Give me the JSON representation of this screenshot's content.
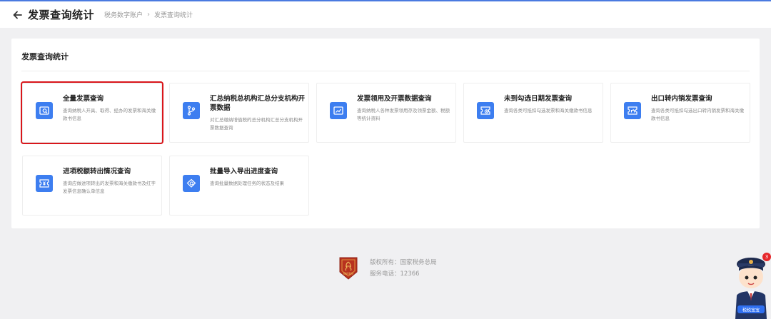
{
  "header": {
    "title": "发票查询统计",
    "breadcrumb": [
      "税务数字账户",
      "发票查询统计"
    ]
  },
  "section": {
    "title": "发票查询统计"
  },
  "cards": [
    {
      "title": "全量发票查询",
      "desc": "查询纳税人开具、取得、经办的发票和海关缴款书信息",
      "icon": "invoice-search-icon"
    },
    {
      "title": "汇总纳税总机构汇总分支机构开票数据",
      "desc": "对汇总缴纳增值税的总分机构汇总分支机构开票数据查询",
      "icon": "branch-icon"
    },
    {
      "title": "发票领用及开票数据查询",
      "desc": "查询纳税人各种发票领用存及领票金额、税额等统计资料",
      "icon": "trend-chart-icon"
    },
    {
      "title": "未到勾选日期发票查询",
      "desc": "查询各类可抵扣勾选发票和海关缴款书信息",
      "icon": "invoice-clock-icon"
    },
    {
      "title": "出口转内销发票查询",
      "desc": "查询各类可抵扣勾选出口转内销发票和海关缴款书信息",
      "icon": "invoice-return-icon"
    },
    {
      "title": "进项税额转出情况查询",
      "desc": "查询应做进项转出的发票和海关缴款书及红字发票信息确认单信息",
      "icon": "invoice-yuan-icon"
    },
    {
      "title": "批量导入导出进度查询",
      "desc": "查询批量数据处理任务的状态及结果",
      "icon": "batch-search-icon"
    }
  ],
  "footer": {
    "emblem_text": "税收宣传",
    "copyright": "版权所有：国家税务总局",
    "phone": "服务电话：12366"
  },
  "assistant": {
    "badge_count": "3",
    "label": "税税宝宝"
  },
  "colors": {
    "accent": "#3d7ef0",
    "highlight": "#d9161b",
    "background": "#f0f0f2"
  }
}
